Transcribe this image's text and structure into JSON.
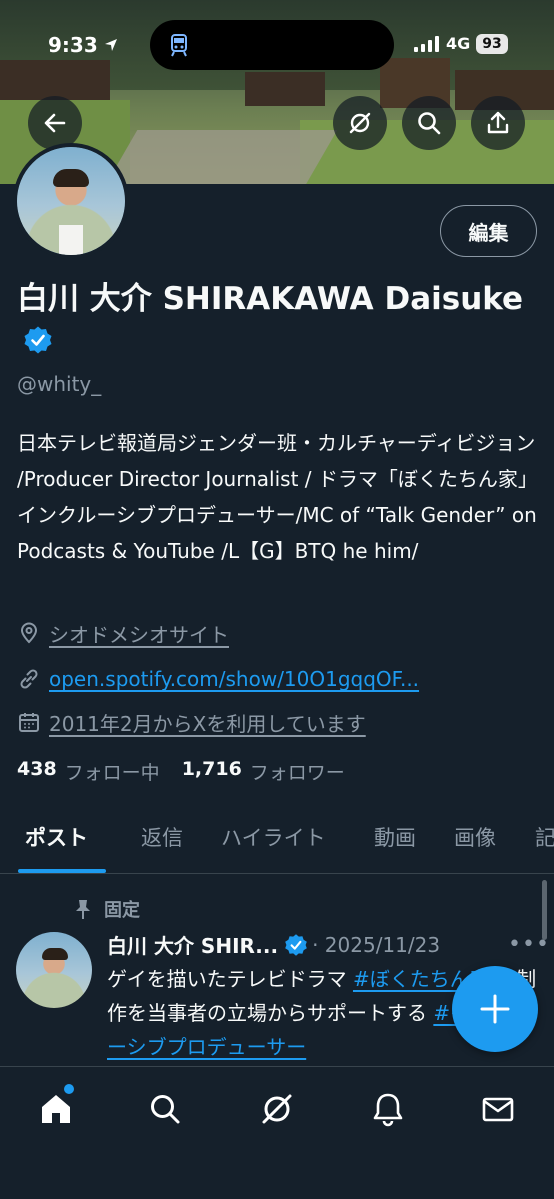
{
  "status_bar": {
    "time": "9:33",
    "network": "4G",
    "battery": "93"
  },
  "profile": {
    "edit_label": "編集",
    "name": "白川 大介 SHIRAKAWA Daisuke",
    "handle": "@whity_",
    "bio": "日本テレビ報道局ジェンダー班・カルチャーディビジョン /Producer Director Journalist / ドラマ「ぼくたちん家」インクルーシブプロデューサー/MC of “Talk Gender” on Podcasts & YouTube /L【G】BTQ he him/",
    "location": "シオドメシオサイト",
    "website": "open.spotify.com/show/10O1gqqOF...",
    "joined": "2011年2月からXを利用しています",
    "following_count": "438",
    "following_label": "フォロー中",
    "followers_count": "1,716",
    "followers_label": "フォロワー"
  },
  "tabs": [
    "ポスト",
    "返信",
    "ハイライト",
    "動画",
    "画像",
    "記"
  ],
  "pinned_post": {
    "pinned_label": "固定",
    "author": "白川 大介 SHIR...",
    "date": "· 2025/11/23",
    "text_part1": "ゲイを描いたテレビドラマ ",
    "hashtag1": "#ぼくたちん家",
    "text_part2": " の制作を当事者の立場からサポートする ",
    "hashtag2": "#インクルーシブプロデューサー"
  },
  "colors": {
    "background": "#15202b",
    "accent": "#1d9bf0",
    "secondary_text": "#8b98a5"
  },
  "icons": {
    "back": "arrow-left-icon",
    "grok": "grok-icon",
    "search": "search-icon",
    "share": "share-icon",
    "verified": "verified-badge-icon",
    "location": "location-pin-icon",
    "link": "link-icon",
    "calendar": "calendar-icon",
    "pin": "pin-icon",
    "compose": "plus-icon",
    "home": "home-icon",
    "explore": "search-icon",
    "grok_nav": "grok-icon",
    "notifications": "bell-icon",
    "messages": "envelope-icon"
  }
}
